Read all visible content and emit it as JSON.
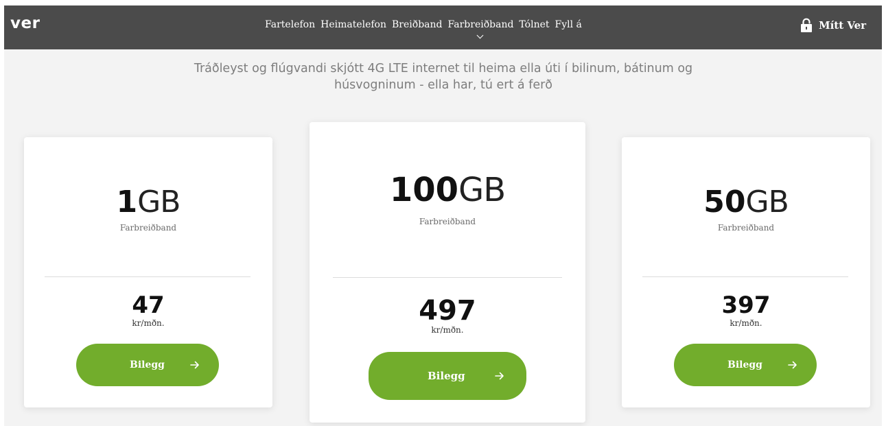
{
  "header": {
    "logo": "ver",
    "nav": [
      {
        "label": "Fartelefon"
      },
      {
        "label": "Heimatelefon"
      },
      {
        "label": "Breiðband"
      },
      {
        "label": "Farbreiðband"
      },
      {
        "label": "Tólnet"
      },
      {
        "label": "Fyll á"
      }
    ],
    "account_label": "Mítt Ver",
    "account_icon": "lock-icon",
    "chevron_icon": "chevron-down-icon"
  },
  "intro": {
    "line1": "Tráðleyst og flúgvandi skjótt 4G LTE internet til heima ella úti í bilinum, bátinum og",
    "line2": "húsvogninum - ella har, tú ert á ferð"
  },
  "plans": [
    {
      "size": "1",
      "unit": "GB",
      "type": "Farbreiðband",
      "price": "47",
      "price_unit": "kr/mðn.",
      "button": "Bilegg",
      "button_icon": "arrow-right-icon"
    },
    {
      "size": "100",
      "unit": "GB",
      "type": "Farbreiðband",
      "price": "497",
      "price_unit": "kr/mðn.",
      "button": "Bilegg",
      "button_icon": "arrow-right-icon"
    },
    {
      "size": "50",
      "unit": "GB",
      "type": "Farbreiðband",
      "price": "397",
      "price_unit": "kr/mðn.",
      "button": "Bilegg",
      "button_icon": "arrow-right-icon"
    }
  ],
  "colors": {
    "header_bg": "#4b4b4b",
    "page_bg": "#f3f3f3",
    "accent_green": "#72ad2c",
    "intro_text": "#7d7d7d"
  }
}
